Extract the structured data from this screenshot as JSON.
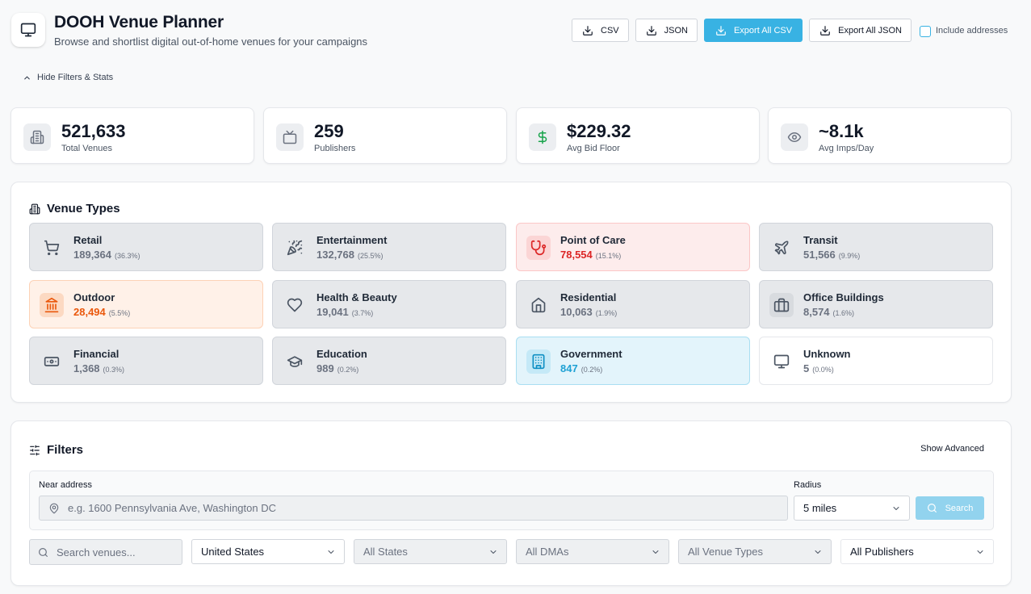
{
  "header": {
    "title": "DOOH Venue Planner",
    "subtitle": "Browse and shortlist digital out-of-home venues for your campaigns",
    "logo_icon": "monitor-icon"
  },
  "toolbar": {
    "csv_label": "CSV",
    "json_label": "JSON",
    "export_all_csv_label": "Export All CSV",
    "export_all_json_label": "Export All JSON",
    "include_addresses_label": "Include addresses",
    "include_addresses_checked": false,
    "accent_color": "#38b2e3"
  },
  "toggle_filters_label": "Hide Filters & Stats",
  "stats": [
    {
      "value": "521,633",
      "label": "Total Venues",
      "icon": "building-icon"
    },
    {
      "value": "259",
      "label": "Publishers",
      "icon": "tv-icon"
    },
    {
      "value": "$229.32",
      "label": "Avg Bid Floor",
      "icon": "dollar-icon",
      "icon_color": "#16a34a"
    },
    {
      "value": "~8.1k",
      "label": "Avg Imps/Day",
      "icon": "eye-icon"
    }
  ],
  "venue_types": {
    "title": "Venue Types",
    "items": [
      {
        "name": "Retail",
        "count": "189,364",
        "pct": "(36.3%)",
        "icon": "cart-icon"
      },
      {
        "name": "Entertainment",
        "count": "132,768",
        "pct": "(25.5%)",
        "icon": "party-popper-icon"
      },
      {
        "name": "Point of Care",
        "count": "78,554",
        "pct": "(15.1%)",
        "icon": "stethoscope-icon",
        "color": "#dc2626"
      },
      {
        "name": "Transit",
        "count": "51,566",
        "pct": "(9.9%)",
        "icon": "plane-icon"
      },
      {
        "name": "Outdoor",
        "count": "28,494",
        "pct": "(5.5%)",
        "icon": "landmark-icon",
        "color": "#ea580c"
      },
      {
        "name": "Health & Beauty",
        "count": "19,041",
        "pct": "(3.7%)",
        "icon": "heart-icon"
      },
      {
        "name": "Residential",
        "count": "10,063",
        "pct": "(1.9%)",
        "icon": "home-icon"
      },
      {
        "name": "Office Buildings",
        "count": "8,574",
        "pct": "(1.6%)",
        "icon": "briefcase-icon"
      },
      {
        "name": "Financial",
        "count": "1,368",
        "pct": "(0.3%)",
        "icon": "banknote-icon"
      },
      {
        "name": "Education",
        "count": "989",
        "pct": "(0.2%)",
        "icon": "graduation-cap-icon"
      },
      {
        "name": "Government",
        "count": "847",
        "pct": "(0.2%)",
        "icon": "building-icon",
        "color": "#1ea1d4"
      },
      {
        "name": "Unknown",
        "count": "5",
        "pct": "(0.0%)",
        "icon": "monitor-icon"
      }
    ]
  },
  "filters": {
    "title": "Filters",
    "show_advanced_label": "Show Advanced",
    "near_address_label": "Near address",
    "near_address_placeholder": "e.g. 1600 Pennsylvania Ave, Washington DC",
    "radius_label": "Radius",
    "radius_value": "5 miles",
    "search_label": "Search",
    "venue_search_placeholder": "Search venues...",
    "country": "United States",
    "state": "All States",
    "dma": "All DMAs",
    "venue_type": "All Venue Types",
    "publisher": "All Publishers"
  }
}
